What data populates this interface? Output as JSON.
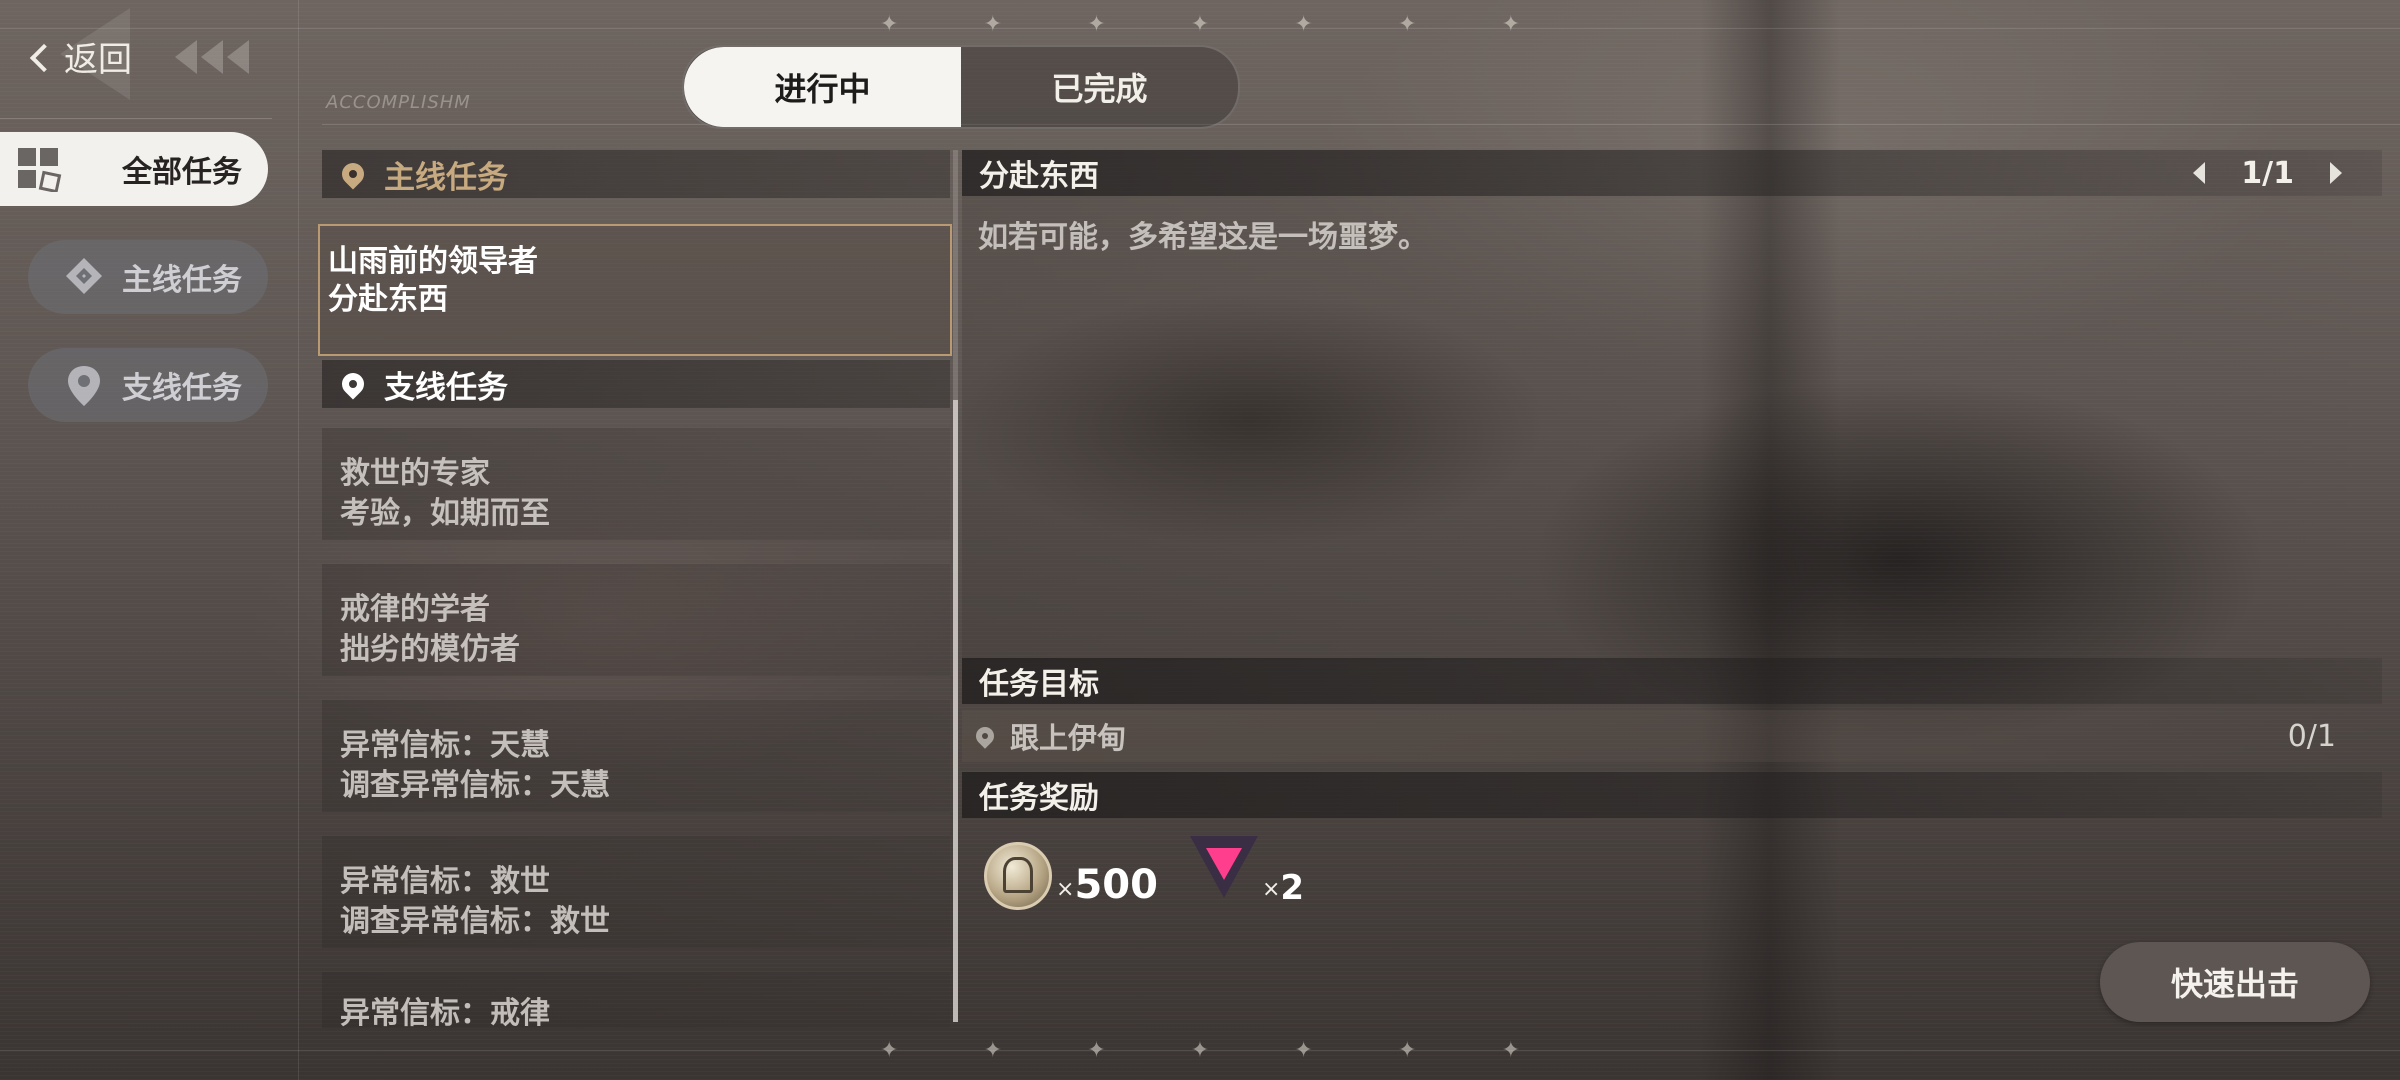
{
  "nav": {
    "back_label": "返回",
    "items": [
      {
        "label": "全部任务",
        "icon": "grid-icon"
      },
      {
        "label": "主线任务",
        "icon": "diamond-icon"
      },
      {
        "label": "支线任务",
        "icon": "location-pin-icon"
      }
    ]
  },
  "header": {
    "watermark": "ACCOMPLISHM",
    "tabs": [
      {
        "label": "进行中",
        "active": true
      },
      {
        "label": "已完成",
        "active": false
      }
    ]
  },
  "quest_list": {
    "main_section": {
      "title": "主线任务",
      "color": "#c8aa80",
      "quests": [
        {
          "line1": "山雨前的领导者",
          "line2": "分赴东西",
          "selected": true
        }
      ]
    },
    "side_section": {
      "title": "支线任务",
      "color": "#ffffff",
      "quests": [
        {
          "line1": "救世的专家",
          "line2": "考验，如期而至"
        },
        {
          "line1": "戒律的学者",
          "line2": "拙劣的模仿者"
        },
        {
          "line1": "异常信标：天慧",
          "line2": "调查异常信标：天慧"
        },
        {
          "line1": "异常信标：救世",
          "line2": "调查异常信标：救世"
        },
        {
          "line1": "异常信标：戒律",
          "line2": ""
        }
      ]
    }
  },
  "detail": {
    "title": "分赴东西",
    "pager": "1/1",
    "description": "如若可能，多希望这是一场噩梦。",
    "objective_header": "任务目标",
    "objective": {
      "text": "跟上伊甸",
      "progress": "0/1"
    },
    "reward_header": "任务奖励",
    "rewards": [
      {
        "icon": "coin-icon",
        "multiplier": "×",
        "qty": "500"
      },
      {
        "icon": "gem-icon",
        "multiplier": "×",
        "qty": "2"
      }
    ],
    "sortie_label": "快速出击"
  },
  "colors": {
    "accent_gold": "#b99a72",
    "tab_active_bg": "#f5f4f1",
    "sortie_bg": "#5e5653"
  }
}
